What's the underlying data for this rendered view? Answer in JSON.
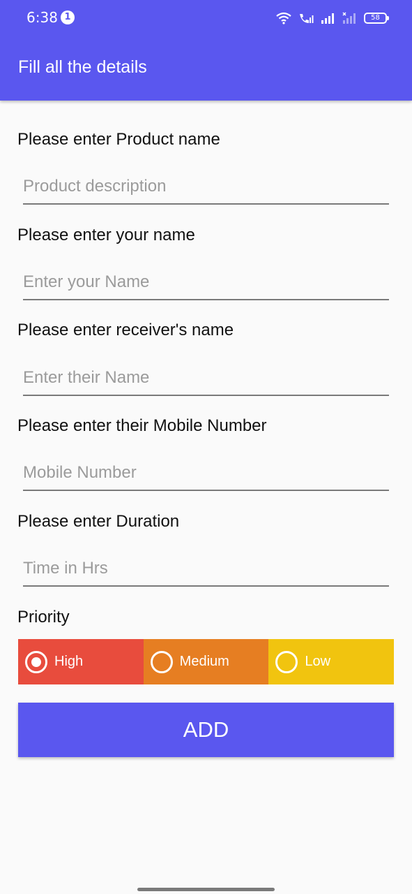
{
  "status_bar": {
    "time": "6:38",
    "notification_count": "1",
    "battery": "58"
  },
  "app_bar": {
    "title": "Fill all the details"
  },
  "form": {
    "product": {
      "label": "Please enter Product name",
      "placeholder": "Product description",
      "value": ""
    },
    "your_name": {
      "label": "Please enter your name",
      "placeholder": "Enter your Name",
      "value": ""
    },
    "receiver_name": {
      "label": "Please enter receiver's name",
      "placeholder": "Enter their Name",
      "value": ""
    },
    "mobile": {
      "label": "Please enter their Mobile Number",
      "placeholder": "Mobile Number",
      "value": ""
    },
    "duration": {
      "label": "Please enter Duration",
      "placeholder": "Time in Hrs",
      "value": ""
    },
    "priority": {
      "label": "Priority",
      "options": [
        {
          "label": "High",
          "selected": true,
          "color": "#e84c3d"
        },
        {
          "label": "Medium",
          "selected": false,
          "color": "#e67e22"
        },
        {
          "label": "Low",
          "selected": false,
          "color": "#f1c40f"
        }
      ]
    },
    "add_button_label": "ADD"
  },
  "colors": {
    "primary": "#5a57ef",
    "background": "#fafafa"
  }
}
